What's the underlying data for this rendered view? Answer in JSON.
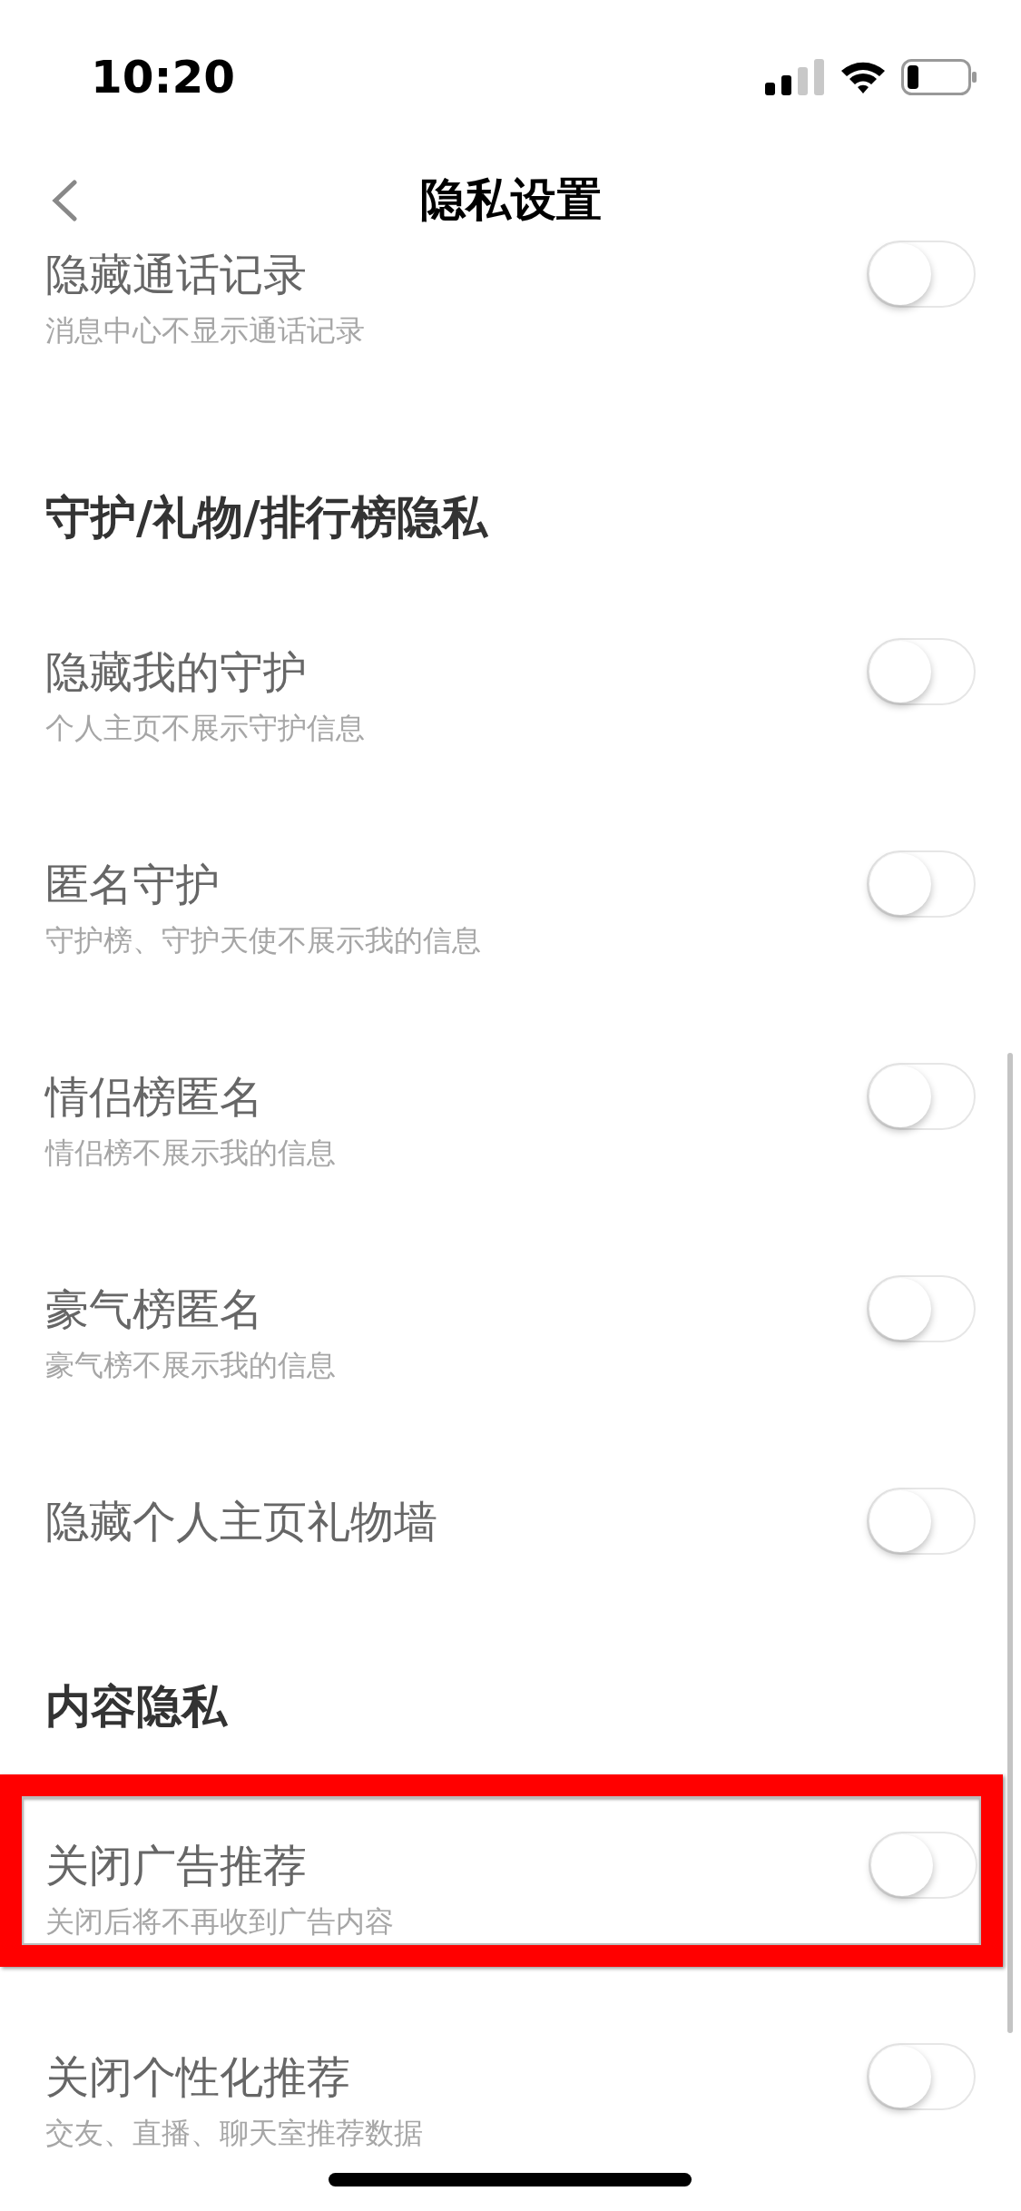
{
  "status_bar": {
    "time": "10:20"
  },
  "nav": {
    "title": "隐私设置"
  },
  "sections": [
    {
      "items": [
        {
          "title": "隐藏通话记录",
          "subtitle": "消息中心不显示通话记录",
          "on": false,
          "highlighted": false
        }
      ]
    },
    {
      "header": "守护/礼物/排行榜隐私",
      "items": [
        {
          "title": "隐藏我的守护",
          "subtitle": "个人主页不展示守护信息",
          "on": false,
          "highlighted": false
        },
        {
          "title": "匿名守护",
          "subtitle": "守护榜、守护天使不展示我的信息",
          "on": false,
          "highlighted": false
        },
        {
          "title": "情侣榜匿名",
          "subtitle": "情侣榜不展示我的信息",
          "on": false,
          "highlighted": false
        },
        {
          "title": "豪气榜匿名",
          "subtitle": "豪气榜不展示我的信息",
          "on": false,
          "highlighted": false
        },
        {
          "title": "隐藏个人主页礼物墙",
          "on": false,
          "highlighted": false
        }
      ]
    },
    {
      "header": "内容隐私",
      "items": [
        {
          "title": "关闭广告推荐",
          "subtitle": "关闭后将不再收到广告内容",
          "on": false,
          "highlighted": true
        },
        {
          "title": "关闭个性化推荐",
          "subtitle": "交友、直播、聊天室推荐数据",
          "on": false,
          "highlighted": false
        }
      ]
    }
  ]
}
